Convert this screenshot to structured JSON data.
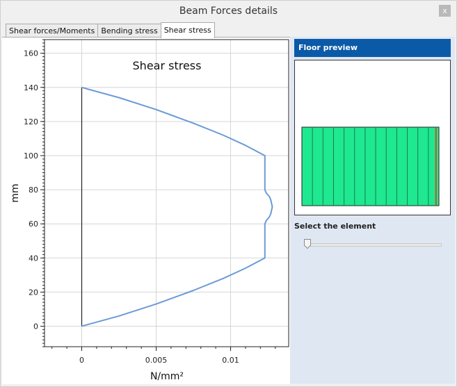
{
  "window": {
    "title": "Beam Forces details",
    "close_label": "x"
  },
  "tabs": [
    {
      "label": "Shear forces/Moments",
      "active": false
    },
    {
      "label": "Bending stress",
      "active": false
    },
    {
      "label": "Shear stress",
      "active": true
    }
  ],
  "chart_data": {
    "type": "line",
    "title": "Shear stress",
    "xlabel": "N/mm²",
    "ylabel": "mm",
    "xlim": [
      -0.0025,
      0.0139
    ],
    "ylim": [
      -12,
      168
    ],
    "x_ticks": [
      0,
      0.005,
      0.01
    ],
    "x_tick_labels": [
      "0",
      "0.005",
      "0.01"
    ],
    "y_ticks": [
      0,
      20,
      40,
      60,
      80,
      100,
      120,
      140,
      160
    ],
    "y_tick_labels": [
      "0",
      "20",
      "40",
      "60",
      "80",
      "100",
      "120",
      "140",
      "160"
    ],
    "grid": true,
    "baseline": {
      "x": [
        0,
        0
      ],
      "y": [
        0,
        140
      ],
      "color": "#222222"
    },
    "series": [
      {
        "color": "#6a9ad8",
        "x": [
          0,
          0.0025,
          0.005,
          0.0075,
          0.0095,
          0.011,
          0.0123,
          0.0123,
          0.0124,
          0.0126,
          0.0127,
          0.0128,
          0.0127,
          0.0126,
          0.0124,
          0.0123,
          0.0123,
          0.011,
          0.0095,
          0.0075,
          0.005,
          0.0025,
          0
        ],
        "y": [
          0,
          6,
          13,
          21,
          28,
          34,
          40,
          60,
          62,
          64,
          66,
          70,
          74,
          76,
          78,
          80,
          100,
          106,
          112,
          119,
          127,
          134,
          140
        ]
      }
    ]
  },
  "preview": {
    "header": "Floor preview",
    "floor_color": "#1ee890",
    "line_color": "#1e7a4e",
    "highlight_color": "#d64a1e",
    "planks": 13,
    "selected_plank": 13
  },
  "selector": {
    "label": "Select the element",
    "value": 0
  }
}
